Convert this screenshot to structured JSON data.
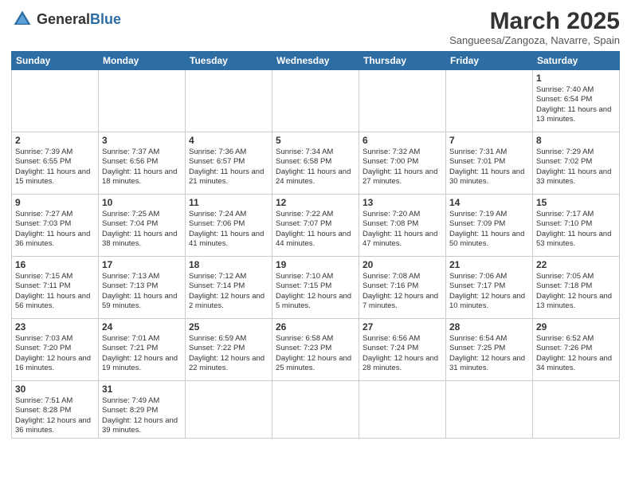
{
  "header": {
    "logo_general": "General",
    "logo_blue": "Blue",
    "month_title": "March 2025",
    "subtitle": "Sangueesa/Zangoza, Navarre, Spain"
  },
  "days_of_week": [
    "Sunday",
    "Monday",
    "Tuesday",
    "Wednesday",
    "Thursday",
    "Friday",
    "Saturday"
  ],
  "weeks": [
    [
      {
        "day": "",
        "info": ""
      },
      {
        "day": "",
        "info": ""
      },
      {
        "day": "",
        "info": ""
      },
      {
        "day": "",
        "info": ""
      },
      {
        "day": "",
        "info": ""
      },
      {
        "day": "",
        "info": ""
      },
      {
        "day": "1",
        "info": "Sunrise: 7:40 AM\nSunset: 6:54 PM\nDaylight: 11 hours and 13 minutes."
      }
    ],
    [
      {
        "day": "2",
        "info": "Sunrise: 7:39 AM\nSunset: 6:55 PM\nDaylight: 11 hours and 15 minutes."
      },
      {
        "day": "3",
        "info": "Sunrise: 7:37 AM\nSunset: 6:56 PM\nDaylight: 11 hours and 18 minutes."
      },
      {
        "day": "4",
        "info": "Sunrise: 7:36 AM\nSunset: 6:57 PM\nDaylight: 11 hours and 21 minutes."
      },
      {
        "day": "5",
        "info": "Sunrise: 7:34 AM\nSunset: 6:58 PM\nDaylight: 11 hours and 24 minutes."
      },
      {
        "day": "6",
        "info": "Sunrise: 7:32 AM\nSunset: 7:00 PM\nDaylight: 11 hours and 27 minutes."
      },
      {
        "day": "7",
        "info": "Sunrise: 7:31 AM\nSunset: 7:01 PM\nDaylight: 11 hours and 30 minutes."
      },
      {
        "day": "8",
        "info": "Sunrise: 7:29 AM\nSunset: 7:02 PM\nDaylight: 11 hours and 33 minutes."
      }
    ],
    [
      {
        "day": "9",
        "info": "Sunrise: 7:27 AM\nSunset: 7:03 PM\nDaylight: 11 hours and 36 minutes."
      },
      {
        "day": "10",
        "info": "Sunrise: 7:25 AM\nSunset: 7:04 PM\nDaylight: 11 hours and 38 minutes."
      },
      {
        "day": "11",
        "info": "Sunrise: 7:24 AM\nSunset: 7:06 PM\nDaylight: 11 hours and 41 minutes."
      },
      {
        "day": "12",
        "info": "Sunrise: 7:22 AM\nSunset: 7:07 PM\nDaylight: 11 hours and 44 minutes."
      },
      {
        "day": "13",
        "info": "Sunrise: 7:20 AM\nSunset: 7:08 PM\nDaylight: 11 hours and 47 minutes."
      },
      {
        "day": "14",
        "info": "Sunrise: 7:19 AM\nSunset: 7:09 PM\nDaylight: 11 hours and 50 minutes."
      },
      {
        "day": "15",
        "info": "Sunrise: 7:17 AM\nSunset: 7:10 PM\nDaylight: 11 hours and 53 minutes."
      }
    ],
    [
      {
        "day": "16",
        "info": "Sunrise: 7:15 AM\nSunset: 7:11 PM\nDaylight: 11 hours and 56 minutes."
      },
      {
        "day": "17",
        "info": "Sunrise: 7:13 AM\nSunset: 7:13 PM\nDaylight: 11 hours and 59 minutes."
      },
      {
        "day": "18",
        "info": "Sunrise: 7:12 AM\nSunset: 7:14 PM\nDaylight: 12 hours and 2 minutes."
      },
      {
        "day": "19",
        "info": "Sunrise: 7:10 AM\nSunset: 7:15 PM\nDaylight: 12 hours and 5 minutes."
      },
      {
        "day": "20",
        "info": "Sunrise: 7:08 AM\nSunset: 7:16 PM\nDaylight: 12 hours and 7 minutes."
      },
      {
        "day": "21",
        "info": "Sunrise: 7:06 AM\nSunset: 7:17 PM\nDaylight: 12 hours and 10 minutes."
      },
      {
        "day": "22",
        "info": "Sunrise: 7:05 AM\nSunset: 7:18 PM\nDaylight: 12 hours and 13 minutes."
      }
    ],
    [
      {
        "day": "23",
        "info": "Sunrise: 7:03 AM\nSunset: 7:20 PM\nDaylight: 12 hours and 16 minutes."
      },
      {
        "day": "24",
        "info": "Sunrise: 7:01 AM\nSunset: 7:21 PM\nDaylight: 12 hours and 19 minutes."
      },
      {
        "day": "25",
        "info": "Sunrise: 6:59 AM\nSunset: 7:22 PM\nDaylight: 12 hours and 22 minutes."
      },
      {
        "day": "26",
        "info": "Sunrise: 6:58 AM\nSunset: 7:23 PM\nDaylight: 12 hours and 25 minutes."
      },
      {
        "day": "27",
        "info": "Sunrise: 6:56 AM\nSunset: 7:24 PM\nDaylight: 12 hours and 28 minutes."
      },
      {
        "day": "28",
        "info": "Sunrise: 6:54 AM\nSunset: 7:25 PM\nDaylight: 12 hours and 31 minutes."
      },
      {
        "day": "29",
        "info": "Sunrise: 6:52 AM\nSunset: 7:26 PM\nDaylight: 12 hours and 34 minutes."
      }
    ],
    [
      {
        "day": "30",
        "info": "Sunrise: 7:51 AM\nSunset: 8:28 PM\nDaylight: 12 hours and 36 minutes."
      },
      {
        "day": "31",
        "info": "Sunrise: 7:49 AM\nSunset: 8:29 PM\nDaylight: 12 hours and 39 minutes."
      },
      {
        "day": "",
        "info": ""
      },
      {
        "day": "",
        "info": ""
      },
      {
        "day": "",
        "info": ""
      },
      {
        "day": "",
        "info": ""
      },
      {
        "day": "",
        "info": ""
      }
    ]
  ]
}
